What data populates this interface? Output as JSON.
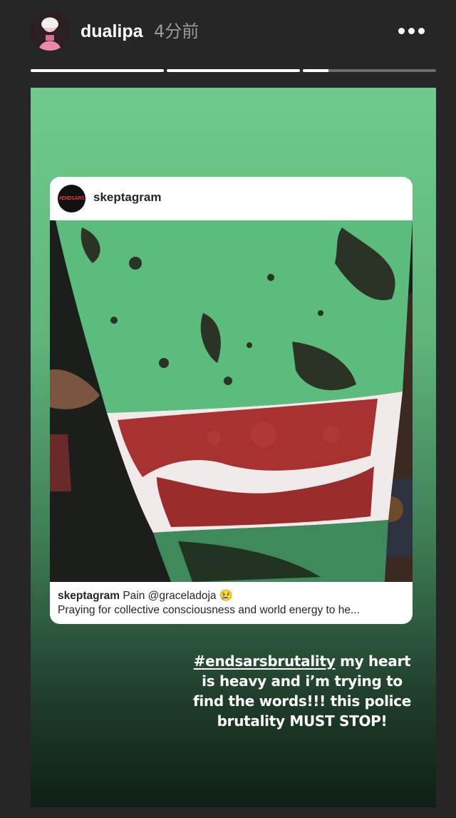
{
  "header": {
    "username": "dualipa",
    "timestamp": "4分前",
    "more_icon": "more-horizontal-icon"
  },
  "progress": [
    {
      "fill": 1.0
    },
    {
      "fill": 1.0
    },
    {
      "fill": 0.19
    }
  ],
  "post": {
    "avatar_text": "#ENDSARS",
    "username": "skeptagram",
    "caption_user": "skeptagram",
    "caption_text": "Pain @graceladoja 😢",
    "caption_line2": "Praying for collective consciousness and world energy to he..."
  },
  "overlay": {
    "hashtag": "#endsarsbrutality",
    "text_after_hashtag": " my heart is heavy and i’m trying to find the words!!! this police brutality MUST STOP!"
  },
  "colors": {
    "accent_green": "#6ecb8d",
    "flag_green": "#5cbc7e",
    "blood_red": "#a83232",
    "background": "#262626"
  }
}
